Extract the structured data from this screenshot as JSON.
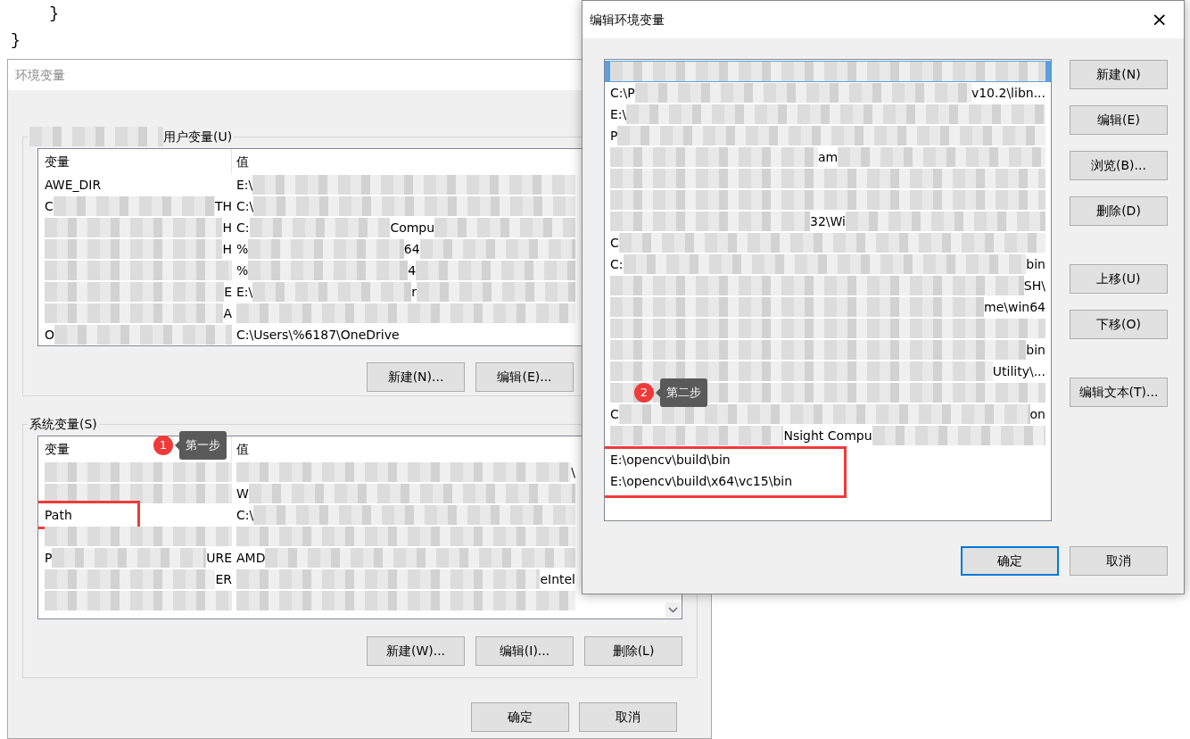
{
  "editor": {
    "lines": [
      "    }",
      "}"
    ]
  },
  "env_dialog": {
    "title": "环境变量",
    "user_group": {
      "label": "用户变量(U)",
      "masked_prefix": true,
      "columns": [
        "变量",
        "值"
      ],
      "rows": [
        {
          "var": [
            {
              "kind": "text",
              "text": "AWE_DIR"
            }
          ],
          "value": [
            {
              "kind": "text",
              "text": "E:\\"
            },
            {
              "kind": "mask"
            }
          ]
        },
        {
          "var": [
            {
              "kind": "text",
              "text": "C"
            },
            {
              "kind": "mask"
            },
            {
              "kind": "text",
              "text": "TH"
            }
          ],
          "value": [
            {
              "kind": "text",
              "text": "C:\\"
            },
            {
              "kind": "mask"
            }
          ]
        },
        {
          "var": [
            {
              "kind": "mask"
            },
            {
              "kind": "text",
              "text": "H"
            }
          ],
          "value": [
            {
              "kind": "text",
              "text": "C:"
            },
            {
              "kind": "mask"
            },
            {
              "kind": "text",
              "text": "Compu"
            },
            {
              "kind": "mask"
            }
          ]
        },
        {
          "var": [
            {
              "kind": "mask"
            },
            {
              "kind": "text",
              "text": "H"
            }
          ],
          "value": [
            {
              "kind": "text",
              "text": "%"
            },
            {
              "kind": "mask"
            },
            {
              "kind": "text",
              "text": "64"
            },
            {
              "kind": "mask"
            }
          ]
        },
        {
          "var": [
            {
              "kind": "mask"
            }
          ],
          "value": [
            {
              "kind": "text",
              "text": "%"
            },
            {
              "kind": "mask"
            },
            {
              "kind": "text",
              "text": "4"
            },
            {
              "kind": "mask"
            }
          ]
        },
        {
          "var": [
            {
              "kind": "mask"
            },
            {
              "kind": "text",
              "text": "E"
            }
          ],
          "value": [
            {
              "kind": "text",
              "text": "E:\\"
            },
            {
              "kind": "mask"
            },
            {
              "kind": "text",
              "text": "r"
            },
            {
              "kind": "mask"
            }
          ]
        },
        {
          "var": [
            {
              "kind": "mask"
            },
            {
              "kind": "text",
              "text": "A"
            }
          ],
          "value": [
            {
              "kind": "mask"
            }
          ]
        },
        {
          "var": [
            {
              "kind": "text",
              "text": "O"
            },
            {
              "kind": "mask"
            }
          ],
          "value": [
            {
              "kind": "text",
              "text": "C:\\Users\\%6187\\OneDrive"
            }
          ]
        }
      ]
    },
    "user_buttons": [
      "新建(N)...",
      "编辑(E)..."
    ],
    "system_group": {
      "label": "系统变量(S)",
      "columns": [
        "变量",
        "值"
      ],
      "rows": [
        {
          "var": [
            {
              "kind": "mask"
            }
          ],
          "value": [
            {
              "kind": "mask"
            },
            {
              "kind": "text",
              "text": "\\"
            }
          ],
          "highlighted": false
        },
        {
          "var": [
            {
              "kind": "mask"
            }
          ],
          "value": [
            {
              "kind": "text",
              "text": "W"
            },
            {
              "kind": "mask"
            }
          ],
          "highlighted": false
        },
        {
          "var": [
            {
              "kind": "text",
              "text": "Path"
            }
          ],
          "value": [
            {
              "kind": "text",
              "text": "C:\\"
            },
            {
              "kind": "mask"
            }
          ],
          "highlighted": true
        },
        {
          "var": [
            {
              "kind": "mask"
            }
          ],
          "value": [
            {
              "kind": "mask"
            }
          ],
          "highlighted": false
        },
        {
          "var": [
            {
              "kind": "text",
              "text": "P"
            },
            {
              "kind": "mask"
            },
            {
              "kind": "text",
              "text": "URE"
            }
          ],
          "value": [
            {
              "kind": "text",
              "text": "AMD"
            },
            {
              "kind": "mask"
            }
          ],
          "highlighted": false
        },
        {
          "var": [
            {
              "kind": "mask"
            },
            {
              "kind": "text",
              "text": "ER"
            }
          ],
          "value": [
            {
              "kind": "mask"
            },
            {
              "kind": "text",
              "text": "eIntel"
            }
          ],
          "highlighted": false
        },
        {
          "var": [
            {
              "kind": "mask"
            }
          ],
          "value": [
            {
              "kind": "mask"
            }
          ],
          "highlighted": false
        }
      ]
    },
    "system_buttons": [
      "新建(W)...",
      "编辑(I)...",
      "删除(L)"
    ],
    "buttons": [
      "确定",
      "取消"
    ]
  },
  "edit_dialog": {
    "title": "编辑环境变量",
    "close": "×",
    "entries": [
      {
        "parts": [
          {
            "kind": "mask"
          }
        ],
        "selected": true,
        "highlighted": false
      },
      {
        "parts": [
          {
            "kind": "text",
            "text": "C:\\P"
          },
          {
            "kind": "mask"
          },
          {
            "kind": "text",
            "text": "v10.2\\libn..."
          }
        ],
        "selected": false,
        "highlighted": false
      },
      {
        "parts": [
          {
            "kind": "text",
            "text": "E:\\"
          },
          {
            "kind": "mask"
          }
        ],
        "selected": false,
        "highlighted": false
      },
      {
        "parts": [
          {
            "kind": "text",
            "text": "P"
          },
          {
            "kind": "mask"
          }
        ],
        "selected": false,
        "highlighted": false
      },
      {
        "parts": [
          {
            "kind": "mask"
          },
          {
            "kind": "text",
            "text": "am"
          },
          {
            "kind": "mask"
          }
        ],
        "selected": false,
        "highlighted": false
      },
      {
        "parts": [
          {
            "kind": "mask"
          }
        ],
        "selected": false,
        "highlighted": false
      },
      {
        "parts": [
          {
            "kind": "mask"
          }
        ],
        "selected": false,
        "highlighted": false
      },
      {
        "parts": [
          {
            "kind": "mask"
          },
          {
            "kind": "text",
            "text": "32\\Wi"
          },
          {
            "kind": "mask"
          }
        ],
        "selected": false,
        "highlighted": false
      },
      {
        "parts": [
          {
            "kind": "text",
            "text": "C"
          },
          {
            "kind": "mask"
          }
        ],
        "selected": false,
        "highlighted": false
      },
      {
        "parts": [
          {
            "kind": "text",
            "text": "C:"
          },
          {
            "kind": "mask"
          },
          {
            "kind": "text",
            "text": "bin"
          }
        ],
        "selected": false,
        "highlighted": false
      },
      {
        "parts": [
          {
            "kind": "mask"
          },
          {
            "kind": "text",
            "text": "SH\\"
          }
        ],
        "selected": false,
        "highlighted": false
      },
      {
        "parts": [
          {
            "kind": "mask"
          },
          {
            "kind": "text",
            "text": "me\\win64"
          }
        ],
        "selected": false,
        "highlighted": false
      },
      {
        "parts": [
          {
            "kind": "mask"
          }
        ],
        "selected": false,
        "highlighted": false
      },
      {
        "parts": [
          {
            "kind": "mask"
          },
          {
            "kind": "text",
            "text": "bin"
          }
        ],
        "selected": false,
        "highlighted": false
      },
      {
        "parts": [
          {
            "kind": "mask"
          },
          {
            "kind": "text",
            "text": "Utility\\..."
          }
        ],
        "selected": false,
        "highlighted": false
      },
      {
        "parts": [
          {
            "kind": "mask"
          }
        ],
        "selected": false,
        "highlighted": false
      },
      {
        "parts": [
          {
            "kind": "text",
            "text": "C"
          },
          {
            "kind": "mask"
          },
          {
            "kind": "text",
            "text": "on"
          }
        ],
        "selected": false,
        "highlighted": false
      },
      {
        "parts": [
          {
            "kind": "mask"
          },
          {
            "kind": "text",
            "text": "Nsight Compu"
          },
          {
            "kind": "mask"
          }
        ],
        "selected": false,
        "highlighted": false
      },
      {
        "parts": [
          {
            "kind": "text",
            "text": "E:\\opencv\\build\\bin"
          }
        ],
        "selected": false,
        "highlighted": true
      },
      {
        "parts": [
          {
            "kind": "text",
            "text": "E:\\opencv\\build\\x64\\vc15\\bin"
          }
        ],
        "selected": false,
        "highlighted": true
      }
    ],
    "side_buttons": [
      "新建(N)",
      "编辑(E)",
      "浏览(B)...",
      "删除(D)",
      "上移(U)",
      "下移(O)",
      "编辑文本(T)..."
    ],
    "buttons": [
      {
        "label": "确定",
        "default": true
      },
      {
        "label": "取消",
        "default": false
      }
    ]
  },
  "annotations": [
    {
      "number": "1",
      "label": "第一步"
    },
    {
      "number": "2",
      "label": "第二步"
    }
  ]
}
